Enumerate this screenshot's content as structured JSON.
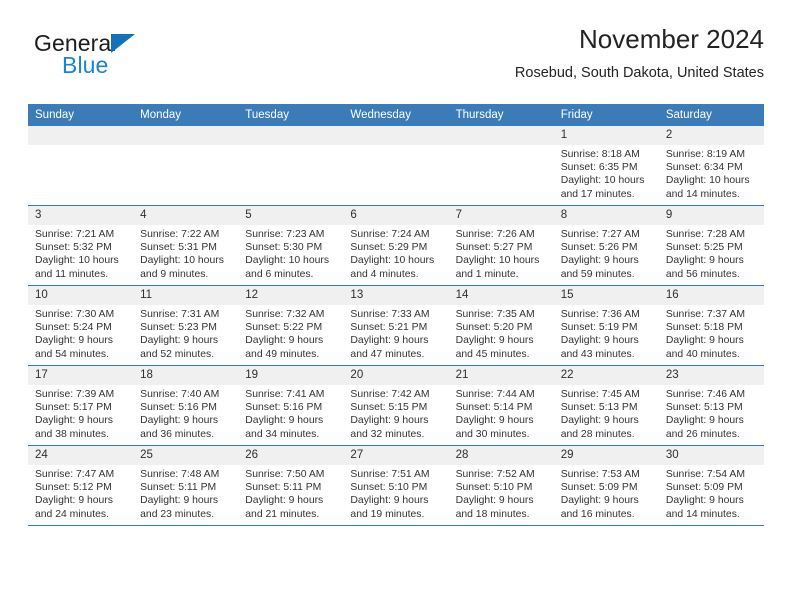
{
  "brand": {
    "name_top": "General",
    "name_bottom": "Blue",
    "triangle_color": "#1271b8",
    "blue_color": "#1b84d0"
  },
  "header": {
    "title": "November 2024",
    "subtitle": "Rosebud, South Dakota, United States"
  },
  "theme": {
    "header_bg": "#3b7cb8",
    "daynum_bg": "#f0f0f0",
    "rule_color": "#3b7cb8"
  },
  "labels": {
    "sunrise": "Sunrise:",
    "sunset": "Sunset:",
    "daylight": "Daylight:"
  },
  "weekdays": [
    "Sunday",
    "Monday",
    "Tuesday",
    "Wednesday",
    "Thursday",
    "Friday",
    "Saturday"
  ],
  "weeks": [
    [
      {
        "day": "",
        "empty": true
      },
      {
        "day": "",
        "empty": true
      },
      {
        "day": "",
        "empty": true
      },
      {
        "day": "",
        "empty": true
      },
      {
        "day": "",
        "empty": true
      },
      {
        "day": "1",
        "sunrise": "Sunrise: 8:18 AM",
        "sunset": "Sunset: 6:35 PM",
        "daylight_1": "Daylight: 10 hours",
        "daylight_2": "and 17 minutes."
      },
      {
        "day": "2",
        "sunrise": "Sunrise: 8:19 AM",
        "sunset": "Sunset: 6:34 PM",
        "daylight_1": "Daylight: 10 hours",
        "daylight_2": "and 14 minutes."
      }
    ],
    [
      {
        "day": "3",
        "sunrise": "Sunrise: 7:21 AM",
        "sunset": "Sunset: 5:32 PM",
        "daylight_1": "Daylight: 10 hours",
        "daylight_2": "and 11 minutes."
      },
      {
        "day": "4",
        "sunrise": "Sunrise: 7:22 AM",
        "sunset": "Sunset: 5:31 PM",
        "daylight_1": "Daylight: 10 hours",
        "daylight_2": "and 9 minutes."
      },
      {
        "day": "5",
        "sunrise": "Sunrise: 7:23 AM",
        "sunset": "Sunset: 5:30 PM",
        "daylight_1": "Daylight: 10 hours",
        "daylight_2": "and 6 minutes."
      },
      {
        "day": "6",
        "sunrise": "Sunrise: 7:24 AM",
        "sunset": "Sunset: 5:29 PM",
        "daylight_1": "Daylight: 10 hours",
        "daylight_2": "and 4 minutes."
      },
      {
        "day": "7",
        "sunrise": "Sunrise: 7:26 AM",
        "sunset": "Sunset: 5:27 PM",
        "daylight_1": "Daylight: 10 hours",
        "daylight_2": "and 1 minute."
      },
      {
        "day": "8",
        "sunrise": "Sunrise: 7:27 AM",
        "sunset": "Sunset: 5:26 PM",
        "daylight_1": "Daylight: 9 hours",
        "daylight_2": "and 59 minutes."
      },
      {
        "day": "9",
        "sunrise": "Sunrise: 7:28 AM",
        "sunset": "Sunset: 5:25 PM",
        "daylight_1": "Daylight: 9 hours",
        "daylight_2": "and 56 minutes."
      }
    ],
    [
      {
        "day": "10",
        "sunrise": "Sunrise: 7:30 AM",
        "sunset": "Sunset: 5:24 PM",
        "daylight_1": "Daylight: 9 hours",
        "daylight_2": "and 54 minutes."
      },
      {
        "day": "11",
        "sunrise": "Sunrise: 7:31 AM",
        "sunset": "Sunset: 5:23 PM",
        "daylight_1": "Daylight: 9 hours",
        "daylight_2": "and 52 minutes."
      },
      {
        "day": "12",
        "sunrise": "Sunrise: 7:32 AM",
        "sunset": "Sunset: 5:22 PM",
        "daylight_1": "Daylight: 9 hours",
        "daylight_2": "and 49 minutes."
      },
      {
        "day": "13",
        "sunrise": "Sunrise: 7:33 AM",
        "sunset": "Sunset: 5:21 PM",
        "daylight_1": "Daylight: 9 hours",
        "daylight_2": "and 47 minutes."
      },
      {
        "day": "14",
        "sunrise": "Sunrise: 7:35 AM",
        "sunset": "Sunset: 5:20 PM",
        "daylight_1": "Daylight: 9 hours",
        "daylight_2": "and 45 minutes."
      },
      {
        "day": "15",
        "sunrise": "Sunrise: 7:36 AM",
        "sunset": "Sunset: 5:19 PM",
        "daylight_1": "Daylight: 9 hours",
        "daylight_2": "and 43 minutes."
      },
      {
        "day": "16",
        "sunrise": "Sunrise: 7:37 AM",
        "sunset": "Sunset: 5:18 PM",
        "daylight_1": "Daylight: 9 hours",
        "daylight_2": "and 40 minutes."
      }
    ],
    [
      {
        "day": "17",
        "sunrise": "Sunrise: 7:39 AM",
        "sunset": "Sunset: 5:17 PM",
        "daylight_1": "Daylight: 9 hours",
        "daylight_2": "and 38 minutes."
      },
      {
        "day": "18",
        "sunrise": "Sunrise: 7:40 AM",
        "sunset": "Sunset: 5:16 PM",
        "daylight_1": "Daylight: 9 hours",
        "daylight_2": "and 36 minutes."
      },
      {
        "day": "19",
        "sunrise": "Sunrise: 7:41 AM",
        "sunset": "Sunset: 5:16 PM",
        "daylight_1": "Daylight: 9 hours",
        "daylight_2": "and 34 minutes."
      },
      {
        "day": "20",
        "sunrise": "Sunrise: 7:42 AM",
        "sunset": "Sunset: 5:15 PM",
        "daylight_1": "Daylight: 9 hours",
        "daylight_2": "and 32 minutes."
      },
      {
        "day": "21",
        "sunrise": "Sunrise: 7:44 AM",
        "sunset": "Sunset: 5:14 PM",
        "daylight_1": "Daylight: 9 hours",
        "daylight_2": "and 30 minutes."
      },
      {
        "day": "22",
        "sunrise": "Sunrise: 7:45 AM",
        "sunset": "Sunset: 5:13 PM",
        "daylight_1": "Daylight: 9 hours",
        "daylight_2": "and 28 minutes."
      },
      {
        "day": "23",
        "sunrise": "Sunrise: 7:46 AM",
        "sunset": "Sunset: 5:13 PM",
        "daylight_1": "Daylight: 9 hours",
        "daylight_2": "and 26 minutes."
      }
    ],
    [
      {
        "day": "24",
        "sunrise": "Sunrise: 7:47 AM",
        "sunset": "Sunset: 5:12 PM",
        "daylight_1": "Daylight: 9 hours",
        "daylight_2": "and 24 minutes."
      },
      {
        "day": "25",
        "sunrise": "Sunrise: 7:48 AM",
        "sunset": "Sunset: 5:11 PM",
        "daylight_1": "Daylight: 9 hours",
        "daylight_2": "and 23 minutes."
      },
      {
        "day": "26",
        "sunrise": "Sunrise: 7:50 AM",
        "sunset": "Sunset: 5:11 PM",
        "daylight_1": "Daylight: 9 hours",
        "daylight_2": "and 21 minutes."
      },
      {
        "day": "27",
        "sunrise": "Sunrise: 7:51 AM",
        "sunset": "Sunset: 5:10 PM",
        "daylight_1": "Daylight: 9 hours",
        "daylight_2": "and 19 minutes."
      },
      {
        "day": "28",
        "sunrise": "Sunrise: 7:52 AM",
        "sunset": "Sunset: 5:10 PM",
        "daylight_1": "Daylight: 9 hours",
        "daylight_2": "and 18 minutes."
      },
      {
        "day": "29",
        "sunrise": "Sunrise: 7:53 AM",
        "sunset": "Sunset: 5:09 PM",
        "daylight_1": "Daylight: 9 hours",
        "daylight_2": "and 16 minutes."
      },
      {
        "day": "30",
        "sunrise": "Sunrise: 7:54 AM",
        "sunset": "Sunset: 5:09 PM",
        "daylight_1": "Daylight: 9 hours",
        "daylight_2": "and 14 minutes."
      }
    ]
  ]
}
